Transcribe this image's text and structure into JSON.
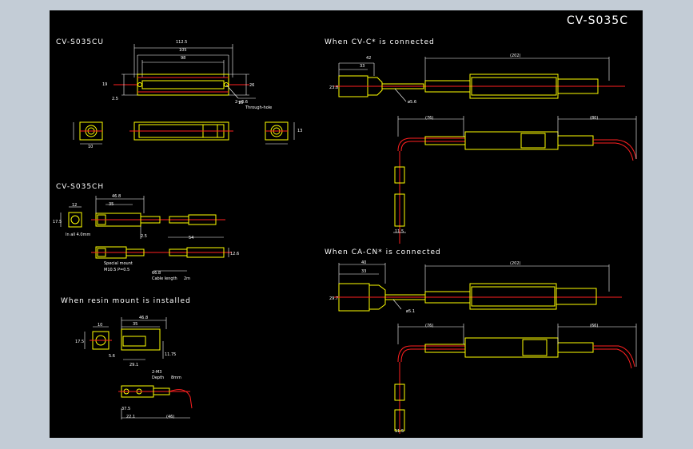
{
  "drawing": {
    "title": "CV-S035C",
    "sections": {
      "cu": "CV-S035CU",
      "ch": "CV-S035CH",
      "resin": "When resin mount is installed",
      "cvc": "When CV-C* is connected",
      "cacn": "When CA-CN* is connected"
    },
    "dims": {
      "cu_1": "112.5",
      "cu_2": "105",
      "cu_3": "98",
      "cu_4": "19",
      "cu_5": "26",
      "cu_6": "2.5",
      "cu_7": "15",
      "cu_8": "2-ø3.6",
      "cu_9": "Through-hole",
      "cu_10": "10",
      "cu_11": "13",
      "ch_1": "46.8",
      "ch_2": "35",
      "ch_3": "12",
      "ch_4": "17.5",
      "ch_5": "2.5",
      "ch_6": "In all 4.0mm",
      "ch_7": "Special mount",
      "ch_8": "M10.5 P=0.5",
      "ch_9": "66.8",
      "ch_10": "Cable length",
      "ch_11": "2m",
      "ch_12": "54",
      "ch_13": "12.6",
      "rs_1": "46.8",
      "rs_2": "35",
      "rs_3": "10",
      "rs_4": "17.5",
      "rs_5": "5.6",
      "rs_6": "29.1",
      "rs_7": "11.75",
      "rs_8": "2-M3",
      "rs_9": "Depth",
      "rs_10": "8mm",
      "rs_11": "37.5",
      "rs_12": "22.1",
      "rs_13": "(46)",
      "c_1": "42",
      "c_2": "33",
      "c_3": "(202)",
      "c_4": "23.8",
      "c_5": "ø5.6",
      "c_6": "(76)",
      "c_7": "(80)",
      "c_8": "11.5",
      "n_1": "40",
      "n_2": "33",
      "n_3": "(202)",
      "n_4": "29.7",
      "n_5": "ø5.1",
      "n_6": "(76)",
      "n_7": "(66)",
      "n_8": "11.5"
    }
  }
}
